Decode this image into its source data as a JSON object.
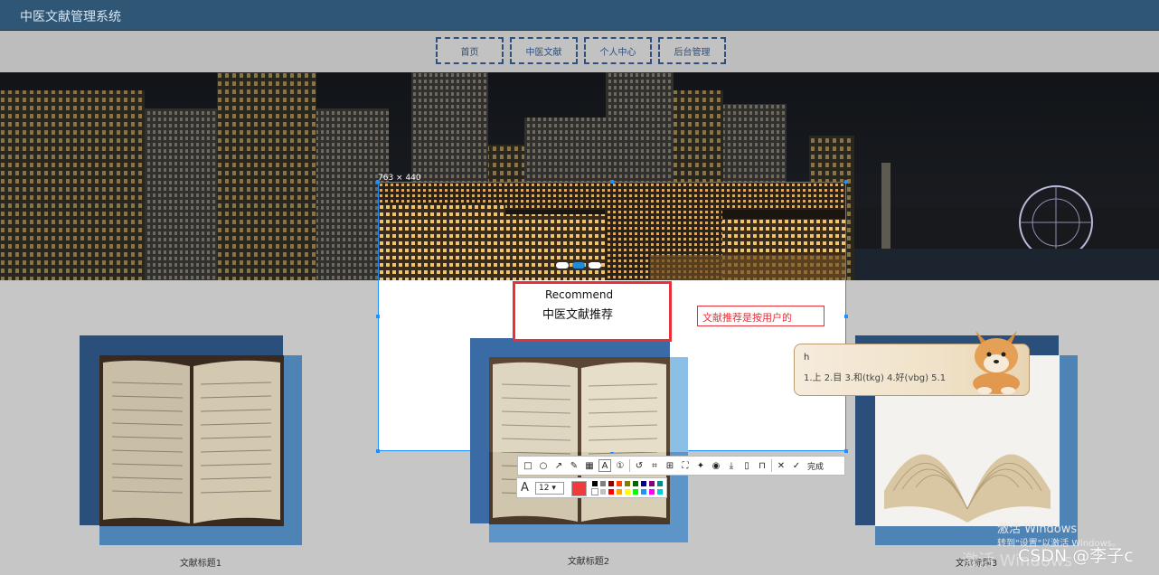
{
  "header": {
    "title": "中医文献管理系统"
  },
  "nav": {
    "items": [
      "首页",
      "中医文献",
      "个人中心",
      "后台管理"
    ]
  },
  "selection": {
    "size_label": "763 × 440"
  },
  "recommend": {
    "en": "Recommend",
    "zh": "中医文献推荐"
  },
  "annotation_text": "文献推荐是按用户的",
  "ime": {
    "input": "h",
    "candidates": "1.上  2.目  3.和(tkg)  4.好(vbg)  5.1"
  },
  "cards": [
    {
      "title": "文献标题1"
    },
    {
      "title": "文献标题2"
    },
    {
      "title": "文献标题3"
    }
  ],
  "toolbar": {
    "icons": [
      "rectangle-icon",
      "ellipse-icon",
      "arrow-icon",
      "pen-icon",
      "mosaic-icon",
      "text-icon",
      "number-icon",
      "undo-icon",
      "ocr-icon",
      "translate-icon",
      "capture-icon",
      "pin-icon",
      "record-icon",
      "download-icon",
      "save-icon",
      "bookmark-icon",
      "close-icon",
      "check-icon"
    ],
    "done_label": "完成"
  },
  "palette": {
    "font_size": "12",
    "current_color": "#ef3b3b",
    "colors": [
      "#000000",
      "#7f7f7f",
      "#8b0000",
      "#ff4500",
      "#808000",
      "#006400",
      "#00008b",
      "#800080",
      "#008b8b",
      "#ffffff",
      "#c0c0c0",
      "#ff0000",
      "#ffa500",
      "#ffff00",
      "#00ff00",
      "#1e90ff",
      "#ff00ff",
      "#00ced1"
    ]
  },
  "watermark": {
    "activate": "激活 Windows",
    "hint": "转到\"设置\"以激活 Windows。",
    "overlay": "激活 Windows"
  },
  "credit": "CSDN @李子c"
}
